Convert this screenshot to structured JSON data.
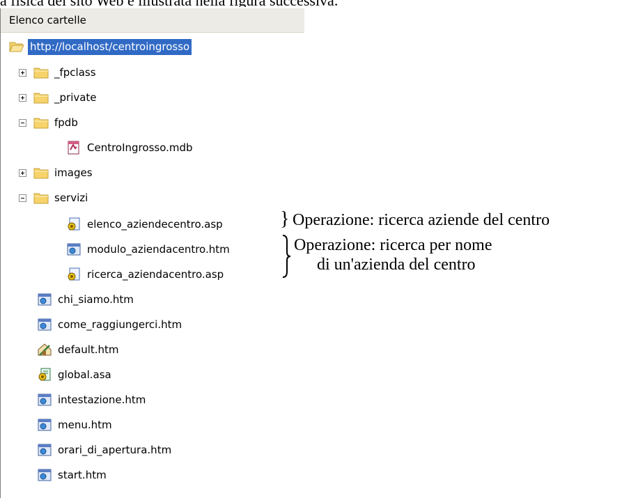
{
  "caption_partial": "a fisica del sito Web è illustrata nella figura successiva.",
  "panel": {
    "title": "Elenco cartelle"
  },
  "tree": {
    "root": "http://localhost/centroingrosso",
    "items": [
      {
        "label": "_fpclass",
        "type": "folder",
        "expander": "plus"
      },
      {
        "label": "_private",
        "type": "folder",
        "expander": "plus"
      },
      {
        "label": "fpdb",
        "type": "folder",
        "expander": "minus"
      },
      {
        "label": "CentroIngrosso.mdb",
        "type": "mdb"
      },
      {
        "label": "images",
        "type": "folder",
        "expander": "plus"
      },
      {
        "label": "servizi",
        "type": "folder",
        "expander": "minus"
      },
      {
        "label": "elenco_aziendecentro.asp",
        "type": "asp"
      },
      {
        "label": "modulo_aziendacentro.htm",
        "type": "htm"
      },
      {
        "label": "ricerca_aziendacentro.asp",
        "type": "asp"
      },
      {
        "label": "chi_siamo.htm",
        "type": "htm"
      },
      {
        "label": "come_raggiungerci.htm",
        "type": "htm"
      },
      {
        "label": "default.htm",
        "type": "home"
      },
      {
        "label": "global.asa",
        "type": "asa"
      },
      {
        "label": "intestazione.htm",
        "type": "htm"
      },
      {
        "label": "menu.htm",
        "type": "htm"
      },
      {
        "label": "orari_di_apertura.htm",
        "type": "htm"
      },
      {
        "label": "start.htm",
        "type": "htm"
      }
    ]
  },
  "annotations": {
    "op1": "Operazione: ricerca aziende del centro",
    "op2_line1": "Operazione: ricerca per nome",
    "op2_line2": "di un'azienda del centro"
  }
}
